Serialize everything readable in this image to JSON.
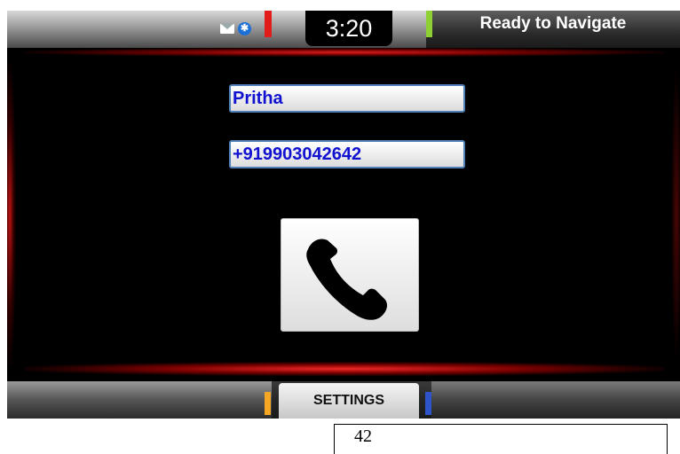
{
  "status_bar": {
    "time": "3:20",
    "nav_status": "Ready to Navigate",
    "icons": [
      "mail-icon",
      "bluetooth-icon"
    ],
    "bluetooth_glyph": "✱"
  },
  "contact": {
    "name": "Pritha",
    "phone": "+919903042642"
  },
  "call_button": {
    "icon": "phone-handset-icon"
  },
  "bottom_bar": {
    "settings_label": "SETTINGS"
  },
  "page_number": "42",
  "colors": {
    "accent_red": "#e21b1b",
    "green_tab": "#8dd135",
    "orange_tab": "#f5a623",
    "blue_tab": "#2d54c8",
    "field_text": "#1111d0"
  }
}
